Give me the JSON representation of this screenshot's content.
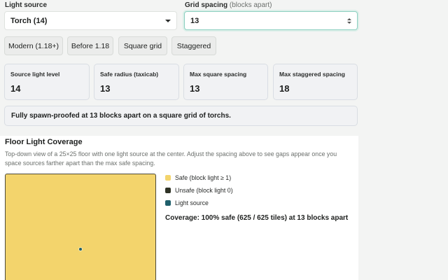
{
  "controls": {
    "light_source_label": "Light source",
    "light_source_value": "Torch (14)",
    "spacing_label": "Grid spacing",
    "spacing_hint": "(blocks apart)",
    "spacing_value": "13"
  },
  "buttons": {
    "modern": "Modern (1.18+)",
    "legacy": "Before 1.18",
    "square": "Square grid",
    "staggered": "Staggered"
  },
  "stats": [
    {
      "label": "Source light level",
      "value": "14"
    },
    {
      "label": "Safe radius (taxicab)",
      "value": "13"
    },
    {
      "label": "Max square spacing",
      "value": "13"
    },
    {
      "label": "Max staggered spacing",
      "value": "18"
    }
  ],
  "banner": "Fully spawn-proofed at 13 blocks apart on a square grid of torchs.",
  "coverage_panel": {
    "title": "Floor Light Coverage",
    "description": "Top-down view of a 25×25 floor with one light source at the center. Adjust the spacing above to see gaps appear once you space sources farther apart than the max safe spacing.",
    "legend": [
      {
        "label": "Safe (block light ≥ 1)",
        "color": "#f3d46c"
      },
      {
        "label": "Unsafe (block light 0)",
        "color": "#2f3326"
      },
      {
        "label": "Light source",
        "color": "#1f5f6b"
      }
    ],
    "summary": "Coverage: 100% safe (625 / 625 tiles) at 13 blocks apart"
  },
  "colors": {
    "accent_focus": "#8ccfc0",
    "safe": "#f3d46c",
    "light_source": "#1f5f6b"
  }
}
